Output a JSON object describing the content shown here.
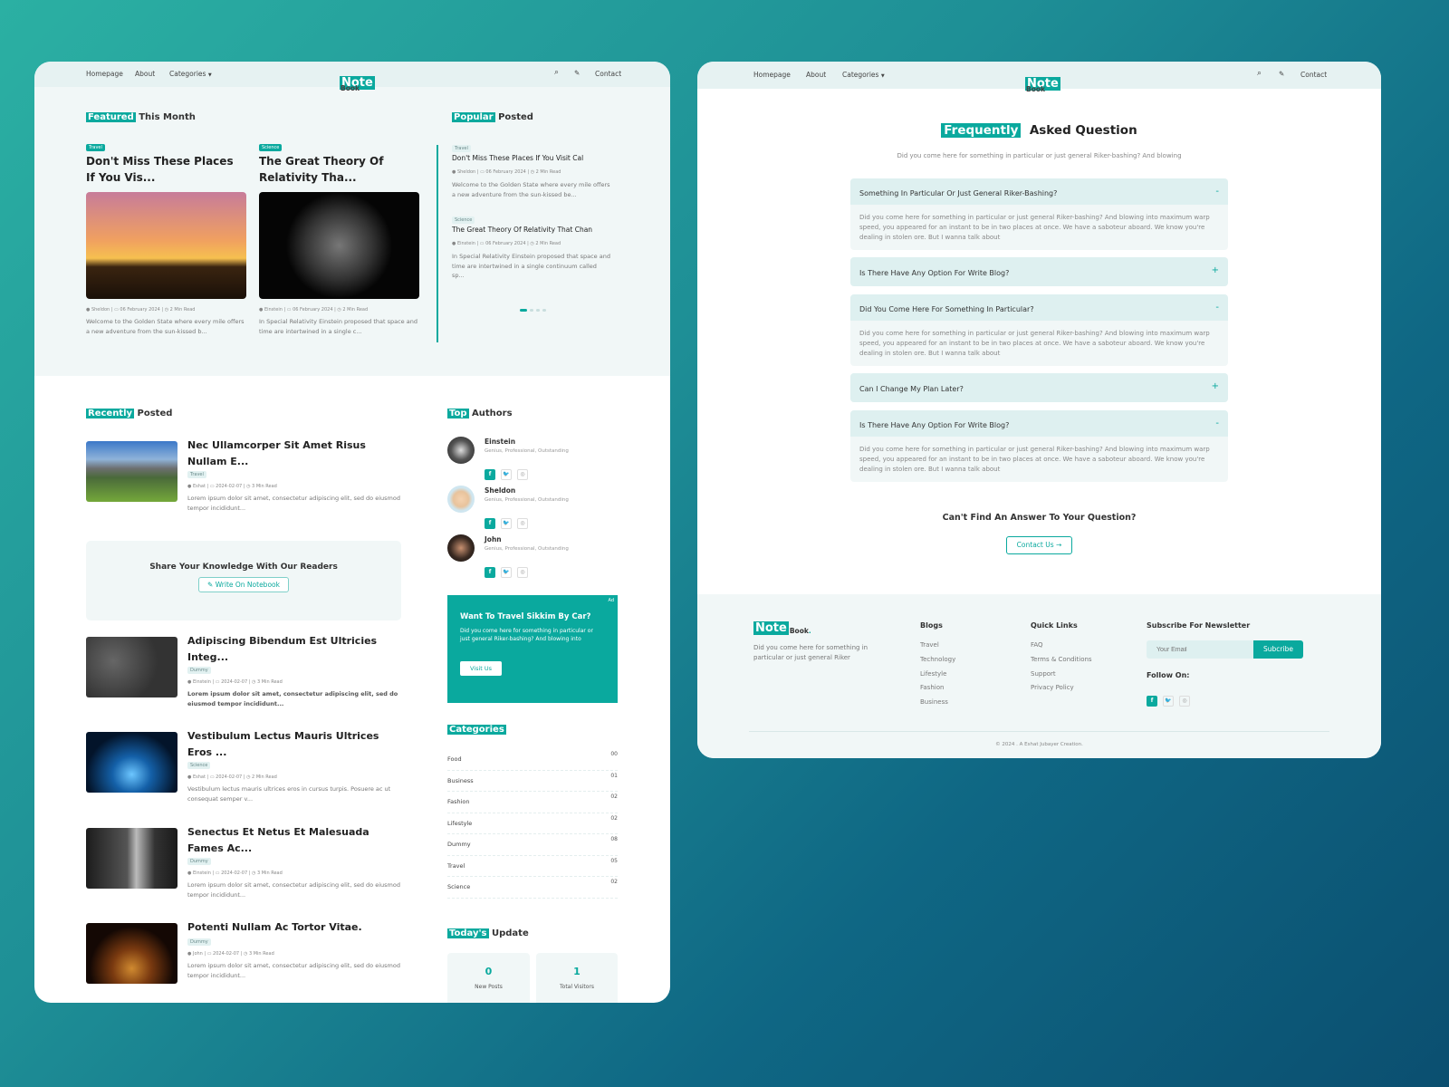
{
  "colors": {
    "accent": "#0aa99e",
    "nav_bg": "#e6f2f2",
    "section_bg": "#f1f7f7"
  },
  "nav": {
    "items": [
      "Homepage",
      "About",
      "Categories"
    ],
    "dropdown_icon": "caret-down-icon",
    "logo_highlight": "Note",
    "logo_rest": "Book",
    "logo_dot": ".",
    "search_icon": "search-icon",
    "write_icon": "edit-icon",
    "contact": "Contact"
  },
  "home": {
    "featured": {
      "highlight": "Featured",
      "rest": "This Month",
      "posts": [
        {
          "tag": "Travel",
          "title": "Don't Miss These Places If You Vis...",
          "author": "Sheldon",
          "date": "06 February 2024",
          "read": "2 Min Read",
          "desc": "Welcome to the Golden State where every mile offers a new adventure from the sun-kissed b..."
        },
        {
          "tag": "Science",
          "title": "The Great Theory Of Relativity Tha...",
          "author": "Einstein",
          "date": "06 February 2024",
          "read": "2 Min Read",
          "desc": "In Special Relativity Einstein proposed that space and time are intertwined in a single c..."
        }
      ]
    },
    "popular": {
      "highlight": "Popular",
      "rest": "Posted",
      "posts": [
        {
          "tag": "Travel",
          "title": "Don't Miss These Places If You Visit Cal",
          "author": "Sheldon",
          "date": "06 February 2024",
          "read": "2 Min Read",
          "desc": "Welcome to the Golden State where every mile offers a new adventure from the sun-kissed be..."
        },
        {
          "tag": "Science",
          "title": "The Great Theory Of Relativity That Chan",
          "author": "Einstein",
          "date": "06 February 2024",
          "read": "2 Min Read",
          "desc": "In Special Relativity Einstein proposed that space and time are intertwined in a single continuum called sp..."
        }
      ],
      "carousel_pages": 4,
      "carousel_active": 1
    },
    "recent": {
      "highlight": "Recently",
      "rest": "Posted",
      "posts": [
        {
          "title": "Nec Ullamcorper Sit Amet Risus Nullam E...",
          "tag": "Travel",
          "author": "Eshat",
          "date": "2024-02-07",
          "read": "3 Min Read",
          "desc": "Lorem ipsum dolor sit amet, consectetur adipiscing elit, sed do eiusmod tempor incididunt..."
        },
        {
          "title": "Adipiscing Bibendum Est Ultricies Integ...",
          "tag": "Dummy",
          "author": "Einstein",
          "date": "2024-02-07",
          "read": "3 Min Read",
          "desc": "Lorem ipsum dolor sit amet, consectetur adipiscing elit, sed do eiusmod tempor incididunt..."
        },
        {
          "title": "Vestibulum Lectus Mauris Ultrices Eros ...",
          "tag": "Science",
          "author": "Eshat",
          "date": "2024-02-07",
          "read": "2 Min Read",
          "desc": "Vestibulum lectus mauris ultrices eros in cursus turpis. Posuere ac ut consequat semper v..."
        },
        {
          "title": "Senectus Et Netus Et Malesuada Fames Ac...",
          "tag": "Dummy",
          "author": "Einstein",
          "date": "2024-02-07",
          "read": "3 Min Read",
          "desc": "Lorem ipsum dolor sit amet, consectetur adipiscing elit, sed do eiusmod tempor incididunt..."
        },
        {
          "title": "Potenti Nullam Ac Tortor Vitae.",
          "tag": "Dummy",
          "author": "John",
          "date": "2024-02-07",
          "read": "3 Min Read",
          "desc": "Lorem ipsum dolor sit amet, consectetur adipiscing elit, sed do eiusmod tempor incididunt..."
        }
      ]
    },
    "share": {
      "title": "Share Your Knowledge With Our Readers",
      "button": "Write On Notebook"
    },
    "authors": {
      "highlight": "Top",
      "rest": "Authors",
      "list": [
        {
          "name": "Einstein",
          "role": "Genius, Professional, Outstanding"
        },
        {
          "name": "Sheldon",
          "role": "Genius, Professional, Outstanding"
        },
        {
          "name": "John",
          "role": "Genius, Professional, Outstanding"
        }
      ]
    },
    "ad": {
      "badge": "Ad",
      "title": "Want To Travel Sikkim By Car?",
      "text": "Did you come here for something in particular or just general Riker-bashing? And blowing into",
      "button": "Visit Us"
    },
    "categories": {
      "title": "Categories",
      "list": [
        {
          "name": "Food",
          "count": "00"
        },
        {
          "name": "Business",
          "count": "01"
        },
        {
          "name": "Fashion",
          "count": "02"
        },
        {
          "name": "Lifestyle",
          "count": "02"
        },
        {
          "name": "Dummy",
          "count": "08"
        },
        {
          "name": "Travel",
          "count": "05"
        },
        {
          "name": "Science",
          "count": "02"
        }
      ]
    },
    "today": {
      "highlight": "Today's",
      "rest": "Update",
      "stats": [
        {
          "value": "0",
          "label": "New Posts"
        },
        {
          "value": "1",
          "label": "Total Visitors"
        }
      ]
    }
  },
  "faq": {
    "highlight": "Frequently",
    "rest": "Asked Question",
    "subtitle": "Did you come here for something in particular or just general Riker-bashing? And blowing",
    "items": [
      {
        "q": "Something In Particular Or Just General Riker-Bashing?",
        "open": true,
        "a": "Did you come here for something in particular or just general Riker-bashing? And blowing into maximum warp speed, you appeared for an instant to be in two places at once. We have a saboteur aboard. We know you're dealing in stolen ore. But I wanna talk about"
      },
      {
        "q": "Is There Have Any Option For Write Blog?",
        "open": false
      },
      {
        "q": "Did You Come Here For Something In Particular?",
        "open": true,
        "a": "Did you come here for something in particular or just general Riker-bashing? And blowing into maximum warp speed, you appeared for an instant to be in two places at once. We have a saboteur aboard. We know you're dealing in stolen ore. But I wanna talk about"
      },
      {
        "q": "Can I Change My Plan Later?",
        "open": false
      },
      {
        "q": "Is There Have Any Option For Write Blog?",
        "open": true,
        "a": "Did you come here for something in particular or just general Riker-bashing? And blowing into maximum warp speed, you appeared for an instant to be in two places at once. We have a saboteur aboard. We know you're dealing in stolen ore. But I wanna talk about"
      }
    ],
    "cta_title": "Can't Find An Answer To Your Question?",
    "cta_button": "Contact Us →"
  },
  "footer": {
    "about": "Did you come here for something in particular or just general Riker",
    "blogs": {
      "title": "Blogs",
      "links": [
        "Travel",
        "Technology",
        "Lifestyle",
        "Fashion",
        "Business"
      ]
    },
    "quick": {
      "title": "Quick Links",
      "links": [
        "FAQ",
        "Terms & Conditions",
        "Support",
        "Privacy Policy"
      ]
    },
    "newsletter": {
      "title": "Subscribe For Newsletter",
      "placeholder": "Your Email",
      "button": "Subcribe",
      "follow": "Follow On:"
    },
    "copyright": "© 2024 . A Eshat Jubayer Creation."
  }
}
